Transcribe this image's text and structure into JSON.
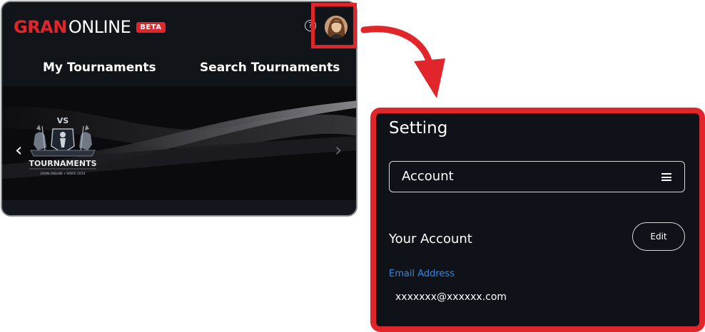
{
  "header": {
    "logo_primary": "GRAN",
    "logo_secondary": "ONLINE",
    "badge": "BETA",
    "help_icon": "question-circle-icon"
  },
  "nav": {
    "tabs": [
      {
        "label": "My Tournaments"
      },
      {
        "label": "Search Tournaments"
      }
    ]
  },
  "banner": {
    "vs_label": "VS",
    "logo_title": "TOURNAMENTS",
    "logo_subtitle": "GRAN ONLINE  •  SINCE 2024",
    "prev_icon": "chevron-left-icon",
    "next_icon": "chevron-right-icon"
  },
  "settings": {
    "title": "Setting",
    "section_select": "Account",
    "menu_icon": "hamburger-menu-icon",
    "your_account": "Your Account",
    "edit_label": "Edit",
    "email_label": "Email Address",
    "email_value": "xxxxxxx@xxxxxx.com"
  },
  "colors": {
    "accent_red": "#e0262b",
    "link_blue": "#2f8be8",
    "panel_bg": "#0f1218",
    "header_bg": "#111419"
  }
}
